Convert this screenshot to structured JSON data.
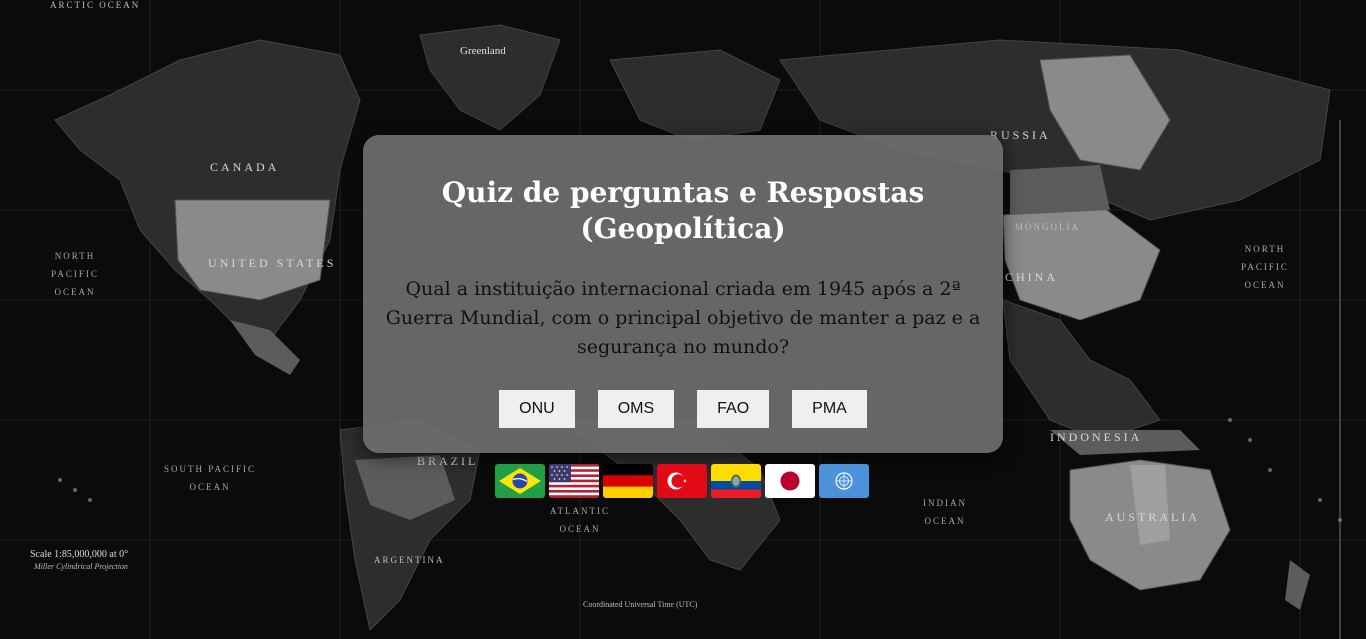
{
  "quiz": {
    "title": "Quiz de perguntas e Respostas (Geopolítica)",
    "question": "Qual a instituição internacional criada em 1945 após a 2ª Guerra Mundial, com o principal objetivo de manter a paz e a segurança no mundo?",
    "answers": [
      "ONU",
      "OMS",
      "FAO",
      "PMA"
    ]
  },
  "flags": [
    {
      "country": "Brasil",
      "icon": "brazil-flag-icon"
    },
    {
      "country": "Estados Unidos",
      "icon": "usa-flag-icon"
    },
    {
      "country": "Alemanha",
      "icon": "germany-flag-icon"
    },
    {
      "country": "Turquia",
      "icon": "turkey-flag-icon"
    },
    {
      "country": "Equador",
      "icon": "ecuador-flag-icon"
    },
    {
      "country": "Japão",
      "icon": "japan-flag-icon"
    },
    {
      "country": "ONU",
      "icon": "un-flag-icon"
    }
  ],
  "map_labels": {
    "canada": "CANADA",
    "united_states": "UNITED STATES",
    "russia": "RUSSIA",
    "china": "CHINA",
    "mongolia": "MONGOLIA",
    "australia": "AUSTRALIA",
    "indonesia": "INDONESIA",
    "brazil": "BRAZIL",
    "argentina": "ARGENTINA",
    "greenland": "Greenland",
    "north_pacific_left": "NORTH PACIFIC OCEAN",
    "north_pacific_right": "NORTH PACIFIC OCEAN",
    "south_pacific": "SOUTH PACIFIC OCEAN",
    "indian_ocean": "INDIAN OCEAN",
    "atlantic": "ATLANTIC OCEAN",
    "arctic": "ARCTIC OCEAN",
    "scale": "Scale 1:85,000,000 at 0°",
    "projection": "Miller Cylindrical Projection",
    "utc": "Coordinated Universal Time (UTC)"
  },
  "colors": {
    "background": "#0b0b0b",
    "land_dark": "#2d2d2d",
    "land_light": "#8a8a8a",
    "card": "#6e6e6e",
    "title": "#ffffff",
    "button": "#efefef"
  }
}
